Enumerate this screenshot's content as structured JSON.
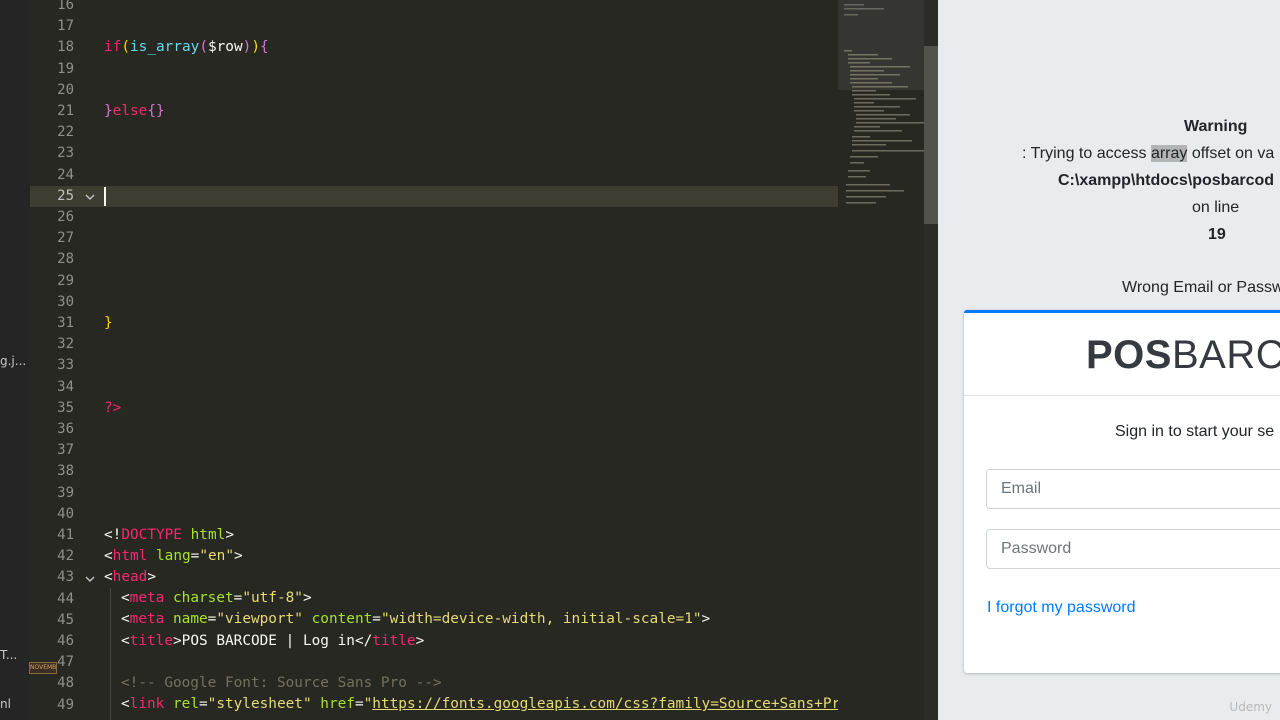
{
  "sidebar": {
    "fragments": [
      "g.j...",
      "T...",
      "nl"
    ],
    "thumb_label": "NOVEMBER"
  },
  "editor": {
    "line_numbers": [
      16,
      17,
      18,
      19,
      20,
      21,
      22,
      23,
      24,
      25,
      26,
      27,
      28,
      29,
      30,
      31,
      32,
      33,
      34,
      35,
      36,
      37,
      38,
      39,
      40,
      41,
      42,
      43,
      44,
      45,
      46,
      47,
      48,
      49
    ],
    "current_line": 25,
    "code": {
      "l18": {
        "a": "if",
        "b": "(",
        "c": "is_array",
        "d": "(",
        "e": "$row",
        "f": ")",
        "g": ")",
        "h": "{"
      },
      "l21": {
        "a": "}",
        "b": "else",
        "c": "{}"
      },
      "l31": {
        "a": "}"
      },
      "l35": {
        "a": "?>"
      },
      "l41": {
        "a": "<!",
        "b": "DOCTYPE",
        "c": " html",
        "d": ">"
      },
      "l42": {
        "a": "<",
        "b": "html",
        "c": " lang",
        "d": "=",
        "e": "\"en\"",
        "f": ">"
      },
      "l43": {
        "a": "<",
        "b": "head",
        "c": ">"
      },
      "l44": {
        "a": "<",
        "b": "meta",
        "c": " charset",
        "d": "=",
        "e": "\"utf-8\"",
        "f": ">"
      },
      "l45": {
        "a": "<",
        "b": "meta",
        "c": " name",
        "d": "=",
        "e": "\"viewport\"",
        "f": " content",
        "g": "=",
        "h": "\"width=device-width, initial-scale=1\"",
        "i": ">"
      },
      "l46": {
        "a": "<",
        "b": "title",
        "c": ">",
        "d": "POS BARCODE | Log in",
        "e": "</",
        "f": "title",
        "g": ">"
      },
      "l48": {
        "a": "<!-- Google Font: Source Sans Pro -->"
      },
      "l49": {
        "a": "<",
        "b": "link",
        "c": " rel",
        "d": "=",
        "e": "\"stylesheet\"",
        "f": " href",
        "g": "=",
        "h": "\"",
        "i": "https://fonts.googleapis.com/css?family=Source+Sans+Pro"
      }
    }
  },
  "browser": {
    "warning_title": "Warning",
    "warning_msg_pre": ": Trying to access ",
    "warning_msg_hl": "array",
    "warning_msg_post": " offset on va",
    "warning_path": "C:\\xampp\\htdocs\\posbarcod",
    "on_line": "on line",
    "line_no": "19",
    "error_msg": "Wrong Email or Passw",
    "brand_bold": "POS",
    "brand_rest": "BARCO",
    "sign_in_msg": "Sign in to start your se",
    "email_placeholder": "Email",
    "password_placeholder": "Password",
    "forgot_link": "I forgot my password",
    "watermark": "Udemy"
  },
  "colors": {
    "accent": "#007bff",
    "editor_bg": "#272822",
    "current_line": "#3e3d32"
  }
}
